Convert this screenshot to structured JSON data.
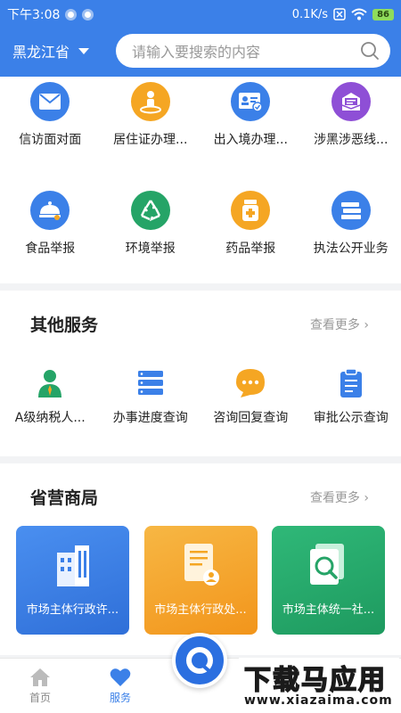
{
  "status": {
    "time": "下午3:08",
    "network_speed": "0.1K/s",
    "battery": "86"
  },
  "header": {
    "province": "黑龙江省",
    "search_placeholder": "请输入要搜索的内容"
  },
  "services_row1": [
    {
      "label": "信访面对面",
      "icon": "envelope-icon",
      "color": "#3b80e8"
    },
    {
      "label": "居住证办理...",
      "icon": "location-person-icon",
      "color": "#f5a623"
    },
    {
      "label": "出入境办理...",
      "icon": "id-card-icon",
      "color": "#3b80e8"
    },
    {
      "label": "涉黑涉恶线...",
      "icon": "report-box-icon",
      "color": "#8e4fd6"
    }
  ],
  "services_row2": [
    {
      "label": "食品举报",
      "icon": "food-cover-icon",
      "color": "#3b80e8"
    },
    {
      "label": "环境举报",
      "icon": "recycle-icon",
      "color": "#25a467"
    },
    {
      "label": "药品举报",
      "icon": "medicine-icon",
      "color": "#f5a623"
    },
    {
      "label": "执法公开业务",
      "icon": "books-icon",
      "color": "#3b80e8"
    }
  ],
  "other_services": {
    "title": "其他服务",
    "more": "查看更多",
    "items": [
      {
        "label": "A级纳税人...",
        "icon": "taxpayer-icon",
        "color": "#25a467"
      },
      {
        "label": "办事进度查询",
        "icon": "progress-list-icon",
        "color": "#3b80e8"
      },
      {
        "label": "咨询回复查询",
        "icon": "chat-bubble-icon",
        "color": "#f5a623"
      },
      {
        "label": "审批公示查询",
        "icon": "clipboard-icon",
        "color": "#3b80e8"
      }
    ]
  },
  "provincial_bureau": {
    "title": "省营商局",
    "more": "查看更多",
    "cards": [
      {
        "label": "市场主体行政许...",
        "icon": "buildings-icon",
        "color": "#3b80e8"
      },
      {
        "label": "市场主体行政处...",
        "icon": "document-person-icon",
        "color": "#f5a623"
      },
      {
        "label": "市场主体统一社...",
        "icon": "search-doc-icon",
        "color": "#25a467"
      }
    ]
  },
  "tabbar": {
    "home": "首页",
    "service": "服务"
  },
  "watermark": {
    "big": "下载马应用",
    "small": "www.xiazaima.com"
  }
}
